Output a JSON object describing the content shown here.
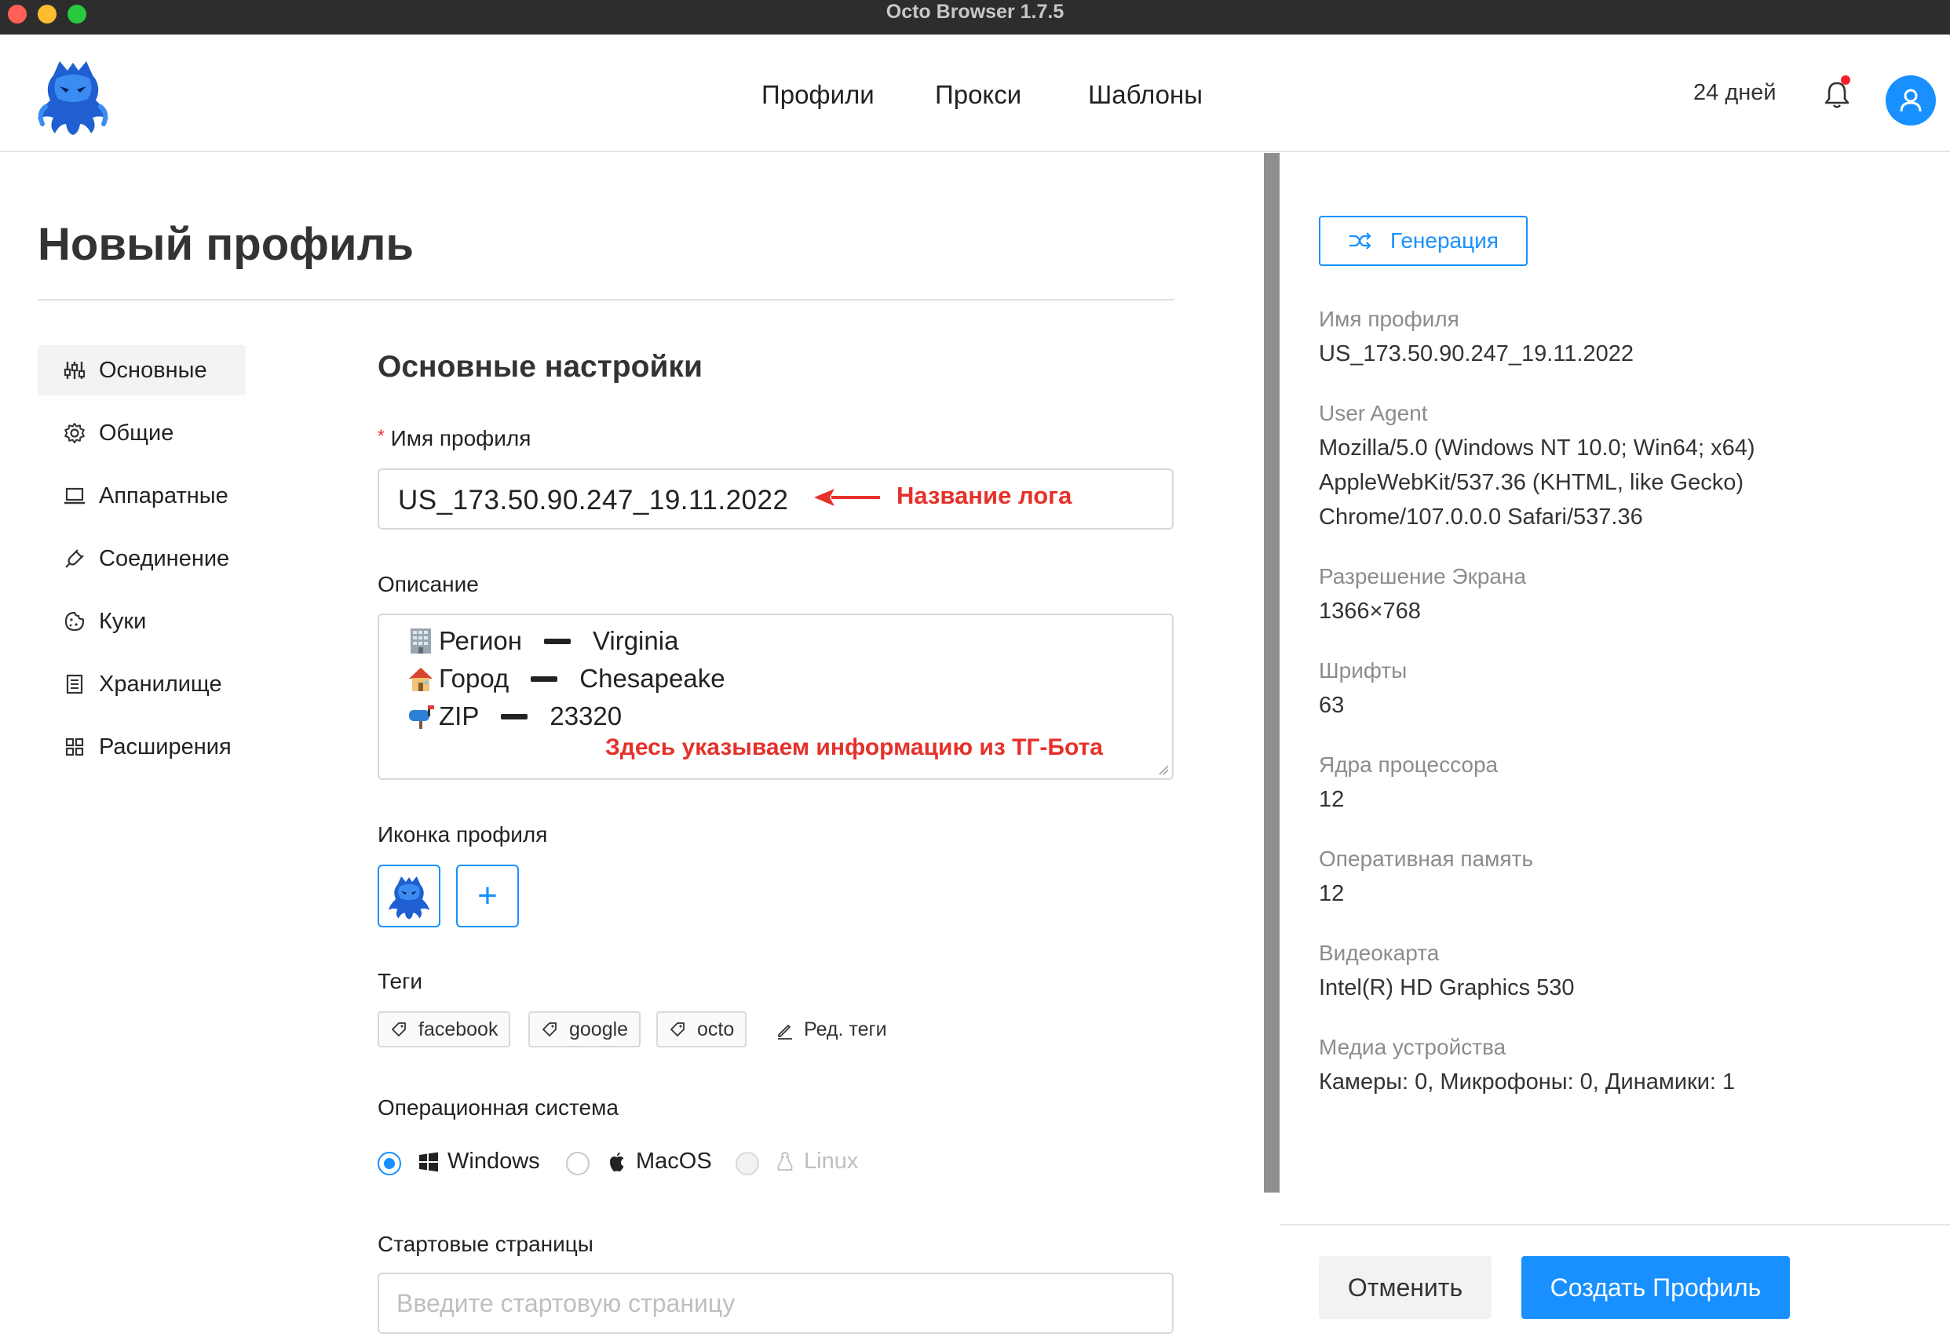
{
  "window": {
    "title": "Octo Browser 1.7.5"
  },
  "nav": {
    "items": [
      "Профили",
      "Прокси",
      "Шаблоны"
    ],
    "days": "24 дней"
  },
  "page": {
    "title": "Новый профиль"
  },
  "side_menu": [
    {
      "label": "Основные",
      "icon": "sliders-icon",
      "active": true
    },
    {
      "label": "Общие",
      "icon": "gear-icon",
      "active": false
    },
    {
      "label": "Аппаратные",
      "icon": "laptop-icon",
      "active": false
    },
    {
      "label": "Соединение",
      "icon": "plug-icon",
      "active": false
    },
    {
      "label": "Куки",
      "icon": "cookie-icon",
      "active": false
    },
    {
      "label": "Хранилище",
      "icon": "storage-icon",
      "active": false
    },
    {
      "label": "Расширения",
      "icon": "grid-icon",
      "active": false
    }
  ],
  "form": {
    "section_title": "Основные настройки",
    "name_label": "Имя профиля",
    "name_required_mark": "*",
    "name_value": "US_173.50.90.247_19.11.2022",
    "name_annotation": "Название лога",
    "description_label": "Описание",
    "description_lines": [
      {
        "emoji": "office-building-icon",
        "key": "Регион",
        "value": "Virginia"
      },
      {
        "emoji": "house-icon",
        "key": "Город",
        "value": "Chesapeake"
      },
      {
        "emoji": "mailbox-icon",
        "key": "ZIP",
        "value": "23320"
      }
    ],
    "description_annotation": "Здесь указываем информацию из ТГ-Бота",
    "icon_label": "Иконка профиля",
    "add_icon_symbol": "+",
    "tags_label": "Теги",
    "tags": [
      "facebook",
      "google",
      "octo"
    ],
    "edit_tags_label": "Ред. теги",
    "os_label": "Операционная система",
    "os_options": [
      {
        "label": "Windows",
        "checked": true,
        "disabled": false
      },
      {
        "label": "MacOS",
        "checked": false,
        "disabled": false
      },
      {
        "label": "Linux",
        "checked": false,
        "disabled": true
      }
    ],
    "start_pages_label": "Стартовые страницы",
    "start_pages_placeholder": "Введите стартовую страницу",
    "start_pages_value": ""
  },
  "summary": {
    "generate_label": "Генерация",
    "items": [
      {
        "label": "Имя профиля",
        "value": "US_173.50.90.247_19.11.2022"
      },
      {
        "label": "User Agent",
        "value": "Mozilla/5.0 (Windows NT 10.0; Win64; x64) AppleWebKit/537.36 (KHTML, like Gecko) Chrome/107.0.0.0 Safari/537.36"
      },
      {
        "label": "Разрешение Экрана",
        "value": "1366×768"
      },
      {
        "label": "Шрифты",
        "value": "63"
      },
      {
        "label": "Ядра процессора",
        "value": "12"
      },
      {
        "label": "Оперативная память",
        "value": "12"
      },
      {
        "label": "Видеокарта",
        "value": "Intel(R) HD Graphics 530"
      },
      {
        "label": "Медиа устройства",
        "value": "Камеры: 0, Микрофоны: 0, Динамики: 1"
      }
    ],
    "cancel_label": "Отменить",
    "create_label": "Создать Профиль"
  },
  "colors": {
    "accent": "#1890ff",
    "annotation": "#e5312a",
    "required": "#f5222d"
  }
}
